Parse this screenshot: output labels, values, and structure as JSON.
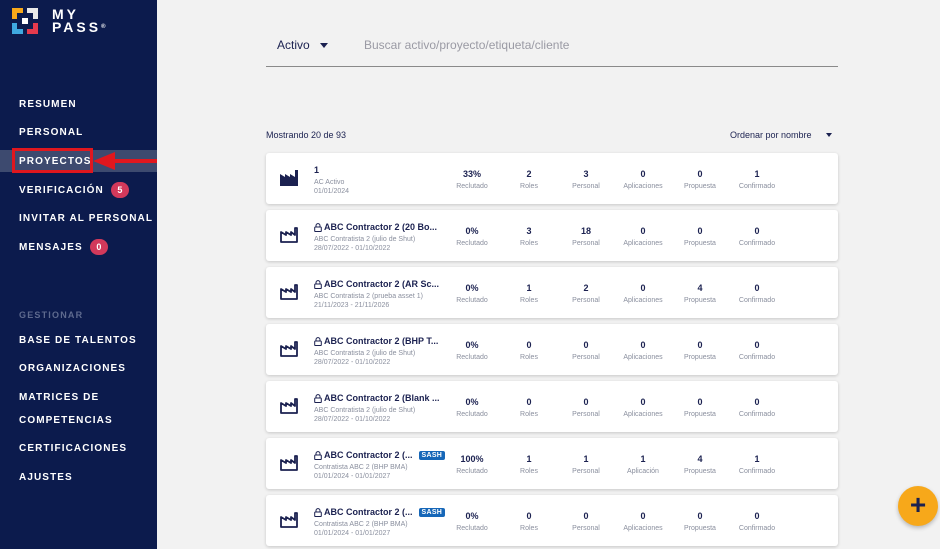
{
  "brand": {
    "line1": "MY",
    "line2": "PASS",
    "mark": "®"
  },
  "nav": {
    "items": [
      {
        "label": "RESUMEN"
      },
      {
        "label": "PERSONAL"
      },
      {
        "label": "PROYECTOS",
        "active": true
      },
      {
        "label": "VERIFICACIÓN",
        "badge": "5"
      },
      {
        "label": "INVITAR AL PERSONAL"
      },
      {
        "label": "MENSAJES",
        "badge": "0"
      }
    ],
    "section_label": "GESTIONAR",
    "manage_items": [
      {
        "label": "BASE DE TALENTOS"
      },
      {
        "label": "ORGANIZACIONES"
      },
      {
        "label": "MATRICES DE"
      },
      {
        "label": "COMPETENCIAS"
      },
      {
        "label": "CERTIFICACIONES"
      },
      {
        "label": "AJUSTES"
      }
    ]
  },
  "filter": {
    "status_value": "Activo",
    "search_placeholder": "Buscar activo/proyecto/etiqueta/cliente"
  },
  "list": {
    "showing": "Mostrando 20 de 93",
    "sort_label": "Ordenar por nombre",
    "stat_labels": [
      "Reclutado",
      "Roles",
      "Personal",
      "Aplicaciones",
      "Propuesta",
      "Confirmado"
    ],
    "projects": [
      {
        "title": "1",
        "locked": false,
        "sash": false,
        "client": "AC Activo",
        "dates": "01/01/2024",
        "stats": [
          "33%",
          "2",
          "3",
          "0",
          "0",
          "1"
        ],
        "labels": [
          "Reclutado",
          "Roles",
          "Personal",
          "Aplicaciones",
          "Propuesta",
          "Confirmado"
        ],
        "icon": "factory-solid-icon"
      },
      {
        "title": "ABC Contractor 2 (20 Bo...",
        "locked": true,
        "sash": false,
        "client": "ABC Contratista 2 (julio de Shut)",
        "dates": "28/07/2022 - 01/10/2022",
        "stats": [
          "0%",
          "3",
          "18",
          "0",
          "0",
          "0"
        ],
        "labels": [
          "Reclutado",
          "Roles",
          "Personal",
          "Aplicaciones",
          "Propuesta",
          "Confirmado"
        ],
        "icon": "factory-outline-icon"
      },
      {
        "title": "ABC Contractor 2 (AR Sc...",
        "locked": true,
        "sash": false,
        "client": "ABC Contratista 2 (prueba asset 1)",
        "dates": "21/11/2023 - 21/11/2026",
        "stats": [
          "0%",
          "1",
          "2",
          "0",
          "4",
          "0"
        ],
        "labels": [
          "Reclutado",
          "Roles",
          "Personal",
          "Aplicaciones",
          "Propuesta",
          "Confirmado"
        ],
        "icon": "factory-outline-icon"
      },
      {
        "title": "ABC Contractor 2 (BHP T...",
        "locked": true,
        "sash": false,
        "client": "ABC Contratista 2 (julio de Shut)",
        "dates": "28/07/2022 - 01/10/2022",
        "stats": [
          "0%",
          "0",
          "0",
          "0",
          "0",
          "0"
        ],
        "labels": [
          "Reclutado",
          "Roles",
          "Personal",
          "Aplicaciones",
          "Propuesta",
          "Confirmado"
        ],
        "icon": "factory-outline-icon"
      },
      {
        "title": "ABC Contractor 2 (Blank ...",
        "locked": true,
        "sash": false,
        "client": "ABC Contratista 2 (julio de Shut)",
        "dates": "28/07/2022 - 01/10/2022",
        "stats": [
          "0%",
          "0",
          "0",
          "0",
          "0",
          "0"
        ],
        "labels": [
          "Reclutado",
          "Roles",
          "Personal",
          "Aplicaciones",
          "Propuesta",
          "Confirmado"
        ],
        "icon": "factory-outline-icon"
      },
      {
        "title": "ABC Contractor 2 (...",
        "locked": true,
        "sash": true,
        "sash_label": "SASH",
        "client": "Contratista ABC 2 (BHP BMA)",
        "dates": "01/01/2024 - 01/01/2027",
        "stats": [
          "100%",
          "1",
          "1",
          "1",
          "4",
          "1"
        ],
        "labels": [
          "Reclutado",
          "Roles",
          "Personal",
          "Aplicación",
          "Propuesta",
          "Confirmado"
        ],
        "icon": "factory-outline-icon"
      },
      {
        "title": "ABC Contractor 2 (...",
        "locked": true,
        "sash": true,
        "sash_label": "SASH",
        "client": "Contratista ABC 2 (BHP BMA)",
        "dates": "01/01/2024 - 01/01/2027",
        "stats": [
          "0%",
          "0",
          "0",
          "0",
          "0",
          "0"
        ],
        "labels": [
          "Reclutado",
          "Roles",
          "Personal",
          "Aplicaciones",
          "Propuesta",
          "Confirmado"
        ],
        "icon": "factory-outline-icon"
      }
    ]
  },
  "fab": {
    "label": "+"
  },
  "colors": {
    "sidebar": "#0c1b4d",
    "accent": "#f7a81a",
    "badge": "#d2395b",
    "highlight": "#e0171e",
    "sash": "#1667b8"
  }
}
